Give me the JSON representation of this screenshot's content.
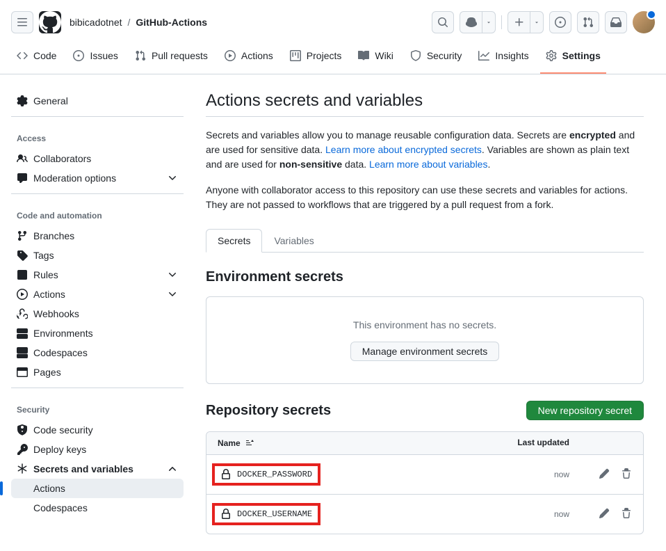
{
  "breadcrumb": {
    "owner": "bibicadotnet",
    "sep": "/",
    "repo": "GitHub-Actions"
  },
  "repoNav": {
    "code": "Code",
    "issues": "Issues",
    "pulls": "Pull requests",
    "actions": "Actions",
    "projects": "Projects",
    "wiki": "Wiki",
    "security": "Security",
    "insights": "Insights",
    "settings": "Settings"
  },
  "sidebar": {
    "general": "General",
    "access": {
      "heading": "Access",
      "collaborators": "Collaborators",
      "moderation": "Moderation options"
    },
    "automation": {
      "heading": "Code and automation",
      "branches": "Branches",
      "tags": "Tags",
      "rules": "Rules",
      "actions": "Actions",
      "webhooks": "Webhooks",
      "environments": "Environments",
      "codespaces": "Codespaces",
      "pages": "Pages"
    },
    "security": {
      "heading": "Security",
      "codeSecurity": "Code security",
      "deployKeys": "Deploy keys",
      "secretsVars": "Secrets and variables",
      "subActions": "Actions",
      "subCodespaces": "Codespaces"
    }
  },
  "page": {
    "title": "Actions secrets and variables",
    "desc1a": "Secrets and variables allow you to manage reusable configuration data. Secrets are ",
    "desc1b": "encrypted",
    "desc1c": " and are used for sensitive data. ",
    "link1": "Learn more about encrypted secrets",
    "desc1d": ". Variables are shown as plain text and are used for ",
    "desc1e": "non-sensitive",
    "desc1f": " data. ",
    "link2": "Learn more about variables",
    "desc1g": ".",
    "desc2": "Anyone with collaborator access to this repository can use these secrets and variables for actions. They are not passed to workflows that are triggered by a pull request from a fork."
  },
  "tabs": {
    "secrets": "Secrets",
    "variables": "Variables"
  },
  "envSection": {
    "title": "Environment secrets",
    "empty": "This environment has no secrets.",
    "btn": "Manage environment secrets"
  },
  "repoSection": {
    "title": "Repository secrets",
    "newBtn": "New repository secret",
    "colName": "Name",
    "colUpdated": "Last updated",
    "secrets": [
      {
        "name": "DOCKER_PASSWORD",
        "updated": "now"
      },
      {
        "name": "DOCKER_USERNAME",
        "updated": "now"
      }
    ]
  }
}
